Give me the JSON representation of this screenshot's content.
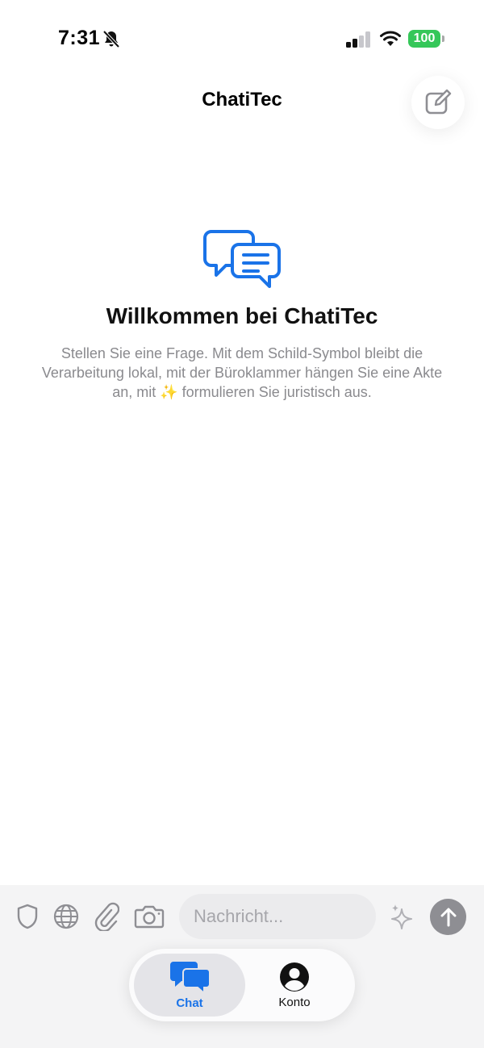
{
  "status_bar": {
    "time": "7:31",
    "icons": [
      "bell-slash-icon",
      "cellular-signal-icon",
      "wifi-icon"
    ],
    "battery": "100",
    "battery_color": "#35c759"
  },
  "header": {
    "title": "ChatiTec",
    "compose_icon": "compose-icon"
  },
  "welcome": {
    "icon": "chat-bubbles-icon",
    "title": "Willkommen bei ChatiTec",
    "text": "Stellen Sie eine Frage. Mit dem Schild-Symbol bleibt die Verarbeitung lokal, mit der Büroklammer hängen Sie eine Akte an, mit ✨ formulieren Sie juristisch aus."
  },
  "composer": {
    "tools": [
      "shield-icon",
      "globe-icon",
      "paperclip-icon",
      "camera-icon"
    ],
    "placeholder": "Nachricht...",
    "value": "",
    "sparkle_icon": "sparkles-icon",
    "send_icon": "arrow-up-icon"
  },
  "tab_bar": {
    "tabs": [
      {
        "label": "Chat",
        "icon": "chat-bubbles-icon",
        "active": true
      },
      {
        "label": "Konto",
        "icon": "person-circle-icon",
        "active": false
      }
    ]
  },
  "colors": {
    "accent": "#1a73e8",
    "send_button": "#8e8e93",
    "secondary_text": "#8a8a8e"
  }
}
